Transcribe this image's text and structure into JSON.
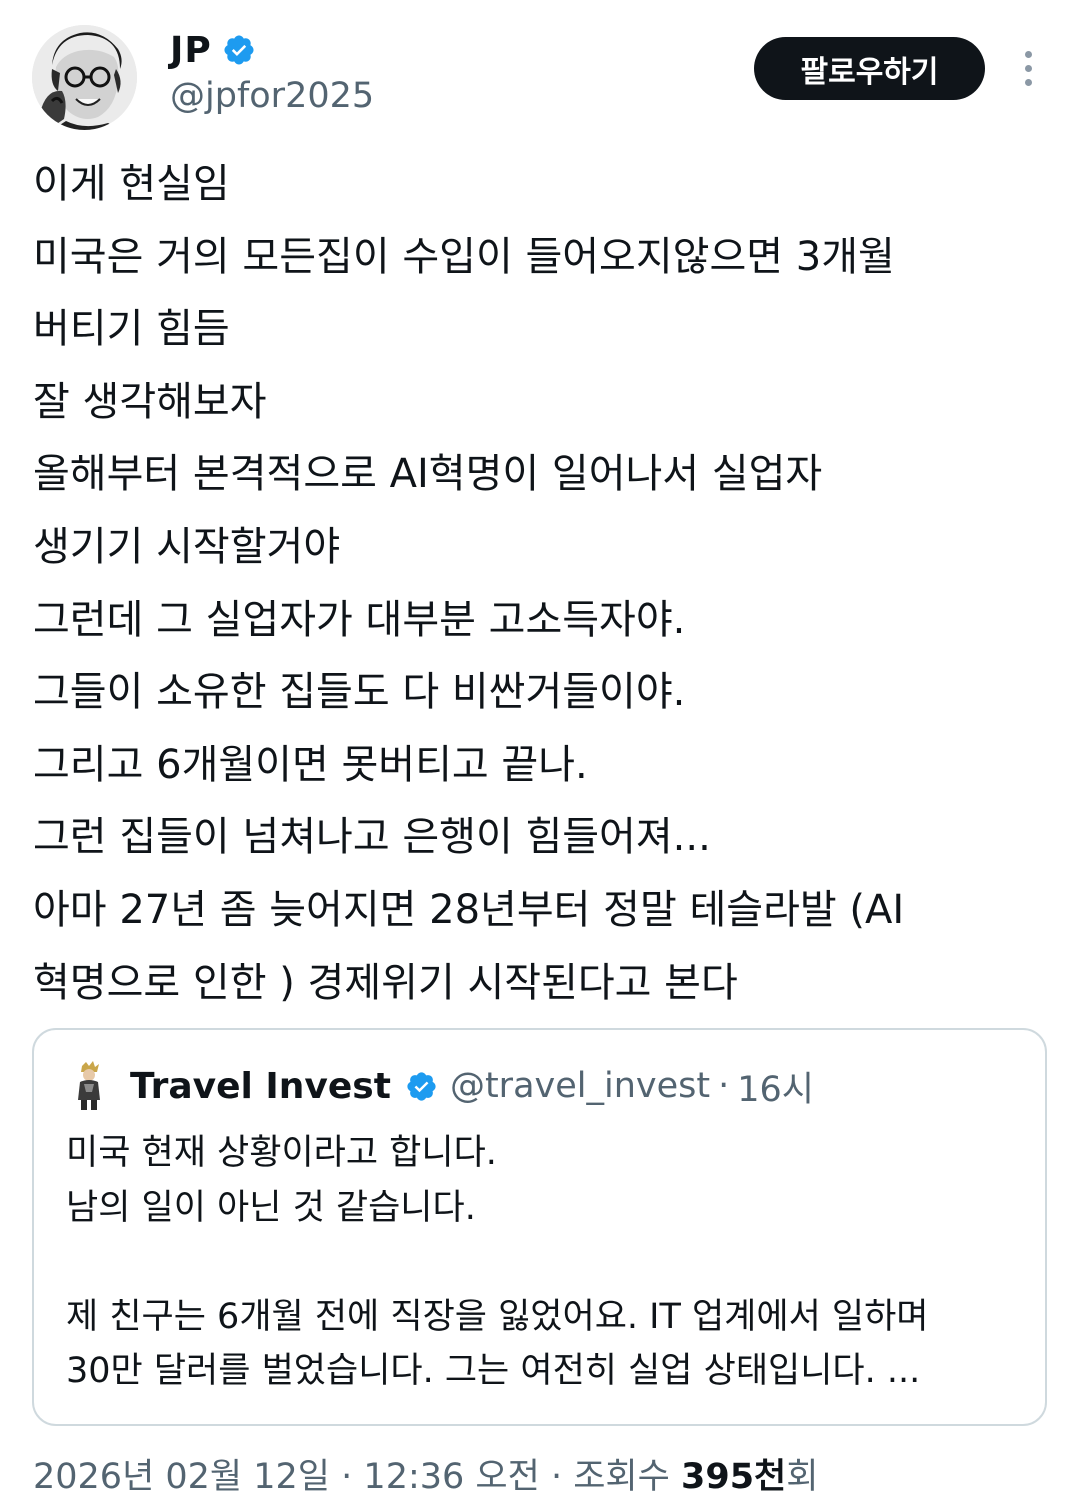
{
  "author": {
    "display_name": "JP",
    "handle": "@jpfor2025",
    "verified": true,
    "avatar_icon": "profile-photo"
  },
  "actions": {
    "follow_label": "팔로우하기",
    "more_icon": "more-vertical-icon"
  },
  "tweet": {
    "lines": [
      "이게 현실임",
      "미국은 거의 모든집이 수입이 들어오지않으면 3개월",
      "버티기 힘듬",
      "잘 생각해보자",
      "올해부터 본격적으로 AI혁명이 일어나서 실업자",
      "생기기 시작할거야",
      "그런데 그 실업자가 대부분 고소득자야.",
      "그들이 소유한 집들도 다 비싼거들이야.",
      "그리고 6개월이면 못버티고 끝나.",
      "그런 집들이 넘쳐나고 은행이 힘들어져...",
      "아마 27년 좀 늦어지면 28년부터 정말 테슬라발 (AI",
      "혁명으로 인한 ) 경제위기 시작된다고 본다"
    ]
  },
  "quoted": {
    "display_name": "Travel Invest",
    "handle": "@travel_invest",
    "separator": "·",
    "time": "16시",
    "verified": true,
    "lines": [
      "미국 현재 상황이라고 합니다.",
      "남의 일이 아닌 것 같습니다.",
      "",
      "제 친구는 6개월 전에 직장을 잃었어요.  IT 업계에서 일하며",
      "30만 달러를 벌었습니다.  그는 여전히 실업 상태입니다.  ..."
    ]
  },
  "meta": {
    "date": "2026년 02월 12일",
    "separator": "·",
    "time": "12:36 오전",
    "views_label": "조회수",
    "views_count": "395천",
    "views_suffix": "회"
  },
  "colors": {
    "text": "#0f1419",
    "secondary": "#536471",
    "verified_blue": "#1d9bf0",
    "border": "#cfd9de",
    "button_bg": "#0f1419"
  }
}
